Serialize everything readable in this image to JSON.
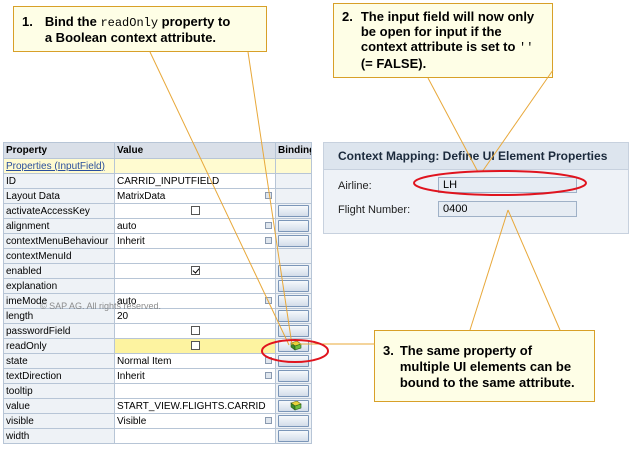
{
  "callout1": {
    "number": "1.",
    "line1_pre": "Bind the ",
    "line1_code": "readOnly",
    "line1_post": " property to",
    "line2": "a Boolean context attribute."
  },
  "callout2": {
    "number": "2.",
    "line1": "The input field will now only",
    "line2": "be open for input if the",
    "line3_pre": "context attribute is set to ",
    "line3_code": "''",
    "line4": "(= FALSE)."
  },
  "callout3": {
    "number": "3.",
    "line1": "The  same property of",
    "line2": "multiple UI elements can be",
    "line3": "bound to the same attribute."
  },
  "table": {
    "headers": {
      "property": "Property",
      "value": "Value",
      "binding": "Binding"
    },
    "section": "Properties (InputField)",
    "rows": [
      {
        "property": "ID",
        "value": "CARRID_INPUTFIELD"
      },
      {
        "property": "Layout Data",
        "value": "MatrixData"
      },
      {
        "property": "activateAccessKey",
        "value": ""
      },
      {
        "property": "alignment",
        "value": "auto"
      },
      {
        "property": "contextMenuBehaviour",
        "value": "Inherit"
      },
      {
        "property": "contextMenuId",
        "value": ""
      },
      {
        "property": "enabled",
        "value": ""
      },
      {
        "property": "explanation",
        "value": ""
      },
      {
        "property": "imeMode",
        "value": "auto"
      },
      {
        "property": "length",
        "value": "20"
      },
      {
        "property": "passwordField",
        "value": ""
      },
      {
        "property": "readOnly",
        "value": ""
      },
      {
        "property": "state",
        "value": "Normal Item"
      },
      {
        "property": "textDirection",
        "value": "Inherit"
      },
      {
        "property": "tooltip",
        "value": ""
      },
      {
        "property": "value",
        "value": "START_VIEW.FLIGHTS.CARRID"
      },
      {
        "property": "visible",
        "value": "Visible"
      },
      {
        "property": "width",
        "value": ""
      }
    ]
  },
  "watermark": "© SAP AG. All rights reserved.",
  "context_panel": {
    "title": "Context Mapping: Define UI Element Properties",
    "airline_label": "Airline:",
    "airline_value": "LH",
    "flight_label": "Flight Number:",
    "flight_value": "0400"
  },
  "colors": {
    "callout_border": "#d8a028",
    "callout_bg": "#fefee6",
    "arrow_color": "#e8a83a",
    "highlight_ellipse": "#e0141e",
    "readonly_highlight": "#fdf3a0"
  }
}
